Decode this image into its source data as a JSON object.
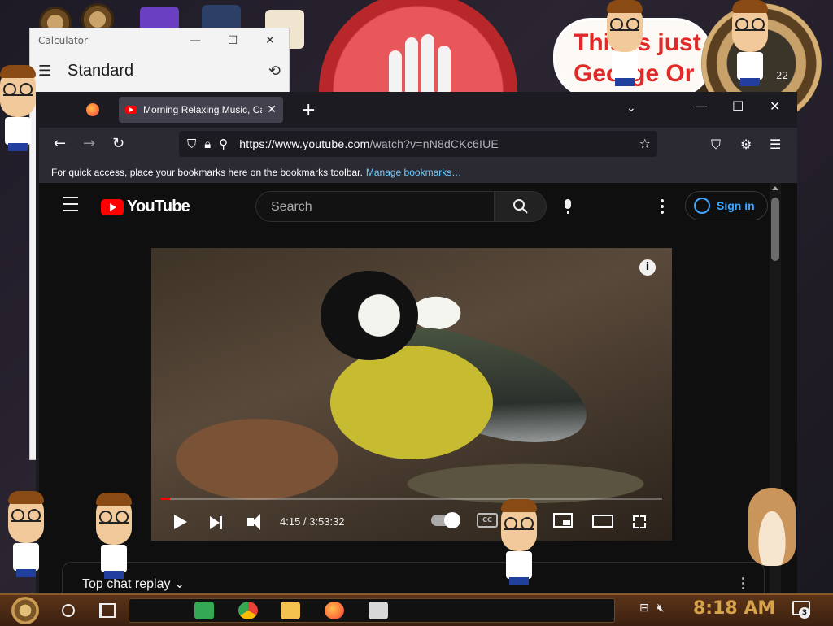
{
  "calculator": {
    "title": "Calculator",
    "mode": "Standard"
  },
  "browser": {
    "tab_title": "Morning Relaxing Music, Calm",
    "url_host": "https://www.youtube.com",
    "url_path": "/watch?v=nN8dCKc6IUE",
    "bookmarks_hint": "For quick access, place your bookmarks here on the bookmarks toolbar.",
    "bookmarks_link": "Manage bookmarks…"
  },
  "youtube": {
    "brand": "YouTube",
    "search_placeholder": "Search",
    "sign_in": "Sign in",
    "player": {
      "current_time": "4:15",
      "duration": "3:53:32",
      "time_display": "4:15 / 3:53:32",
      "progress_fraction": 0.018
    },
    "chat_label": "Top chat replay"
  },
  "desktop": {
    "sticker_line1": "This is just",
    "sticker_line2": "George Or",
    "clock_badge": "22"
  },
  "taskbar": {
    "time": "8:18 AM",
    "notification_count": "3"
  },
  "colors": {
    "youtube_red": "#ff0000",
    "link_blue": "#6fcdff",
    "signin_blue": "#3ea6ff",
    "clock_gold": "#d6a24a"
  }
}
